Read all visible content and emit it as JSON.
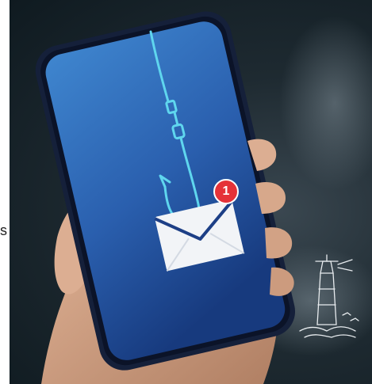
{
  "image": {
    "edge_text": "s",
    "notification_count": "1",
    "colors": {
      "screen_top": "#3a7fc8",
      "screen_bottom": "#1b3f86",
      "line": "#5fd6ee",
      "badge": "#e53238",
      "envelope": "#f2f4f7",
      "phone_frame": "#15203a",
      "skin": "#d9a98a"
    },
    "icons": [
      "fishing-hook-icon",
      "envelope-icon",
      "notification-badge",
      "lighthouse-logo"
    ]
  }
}
